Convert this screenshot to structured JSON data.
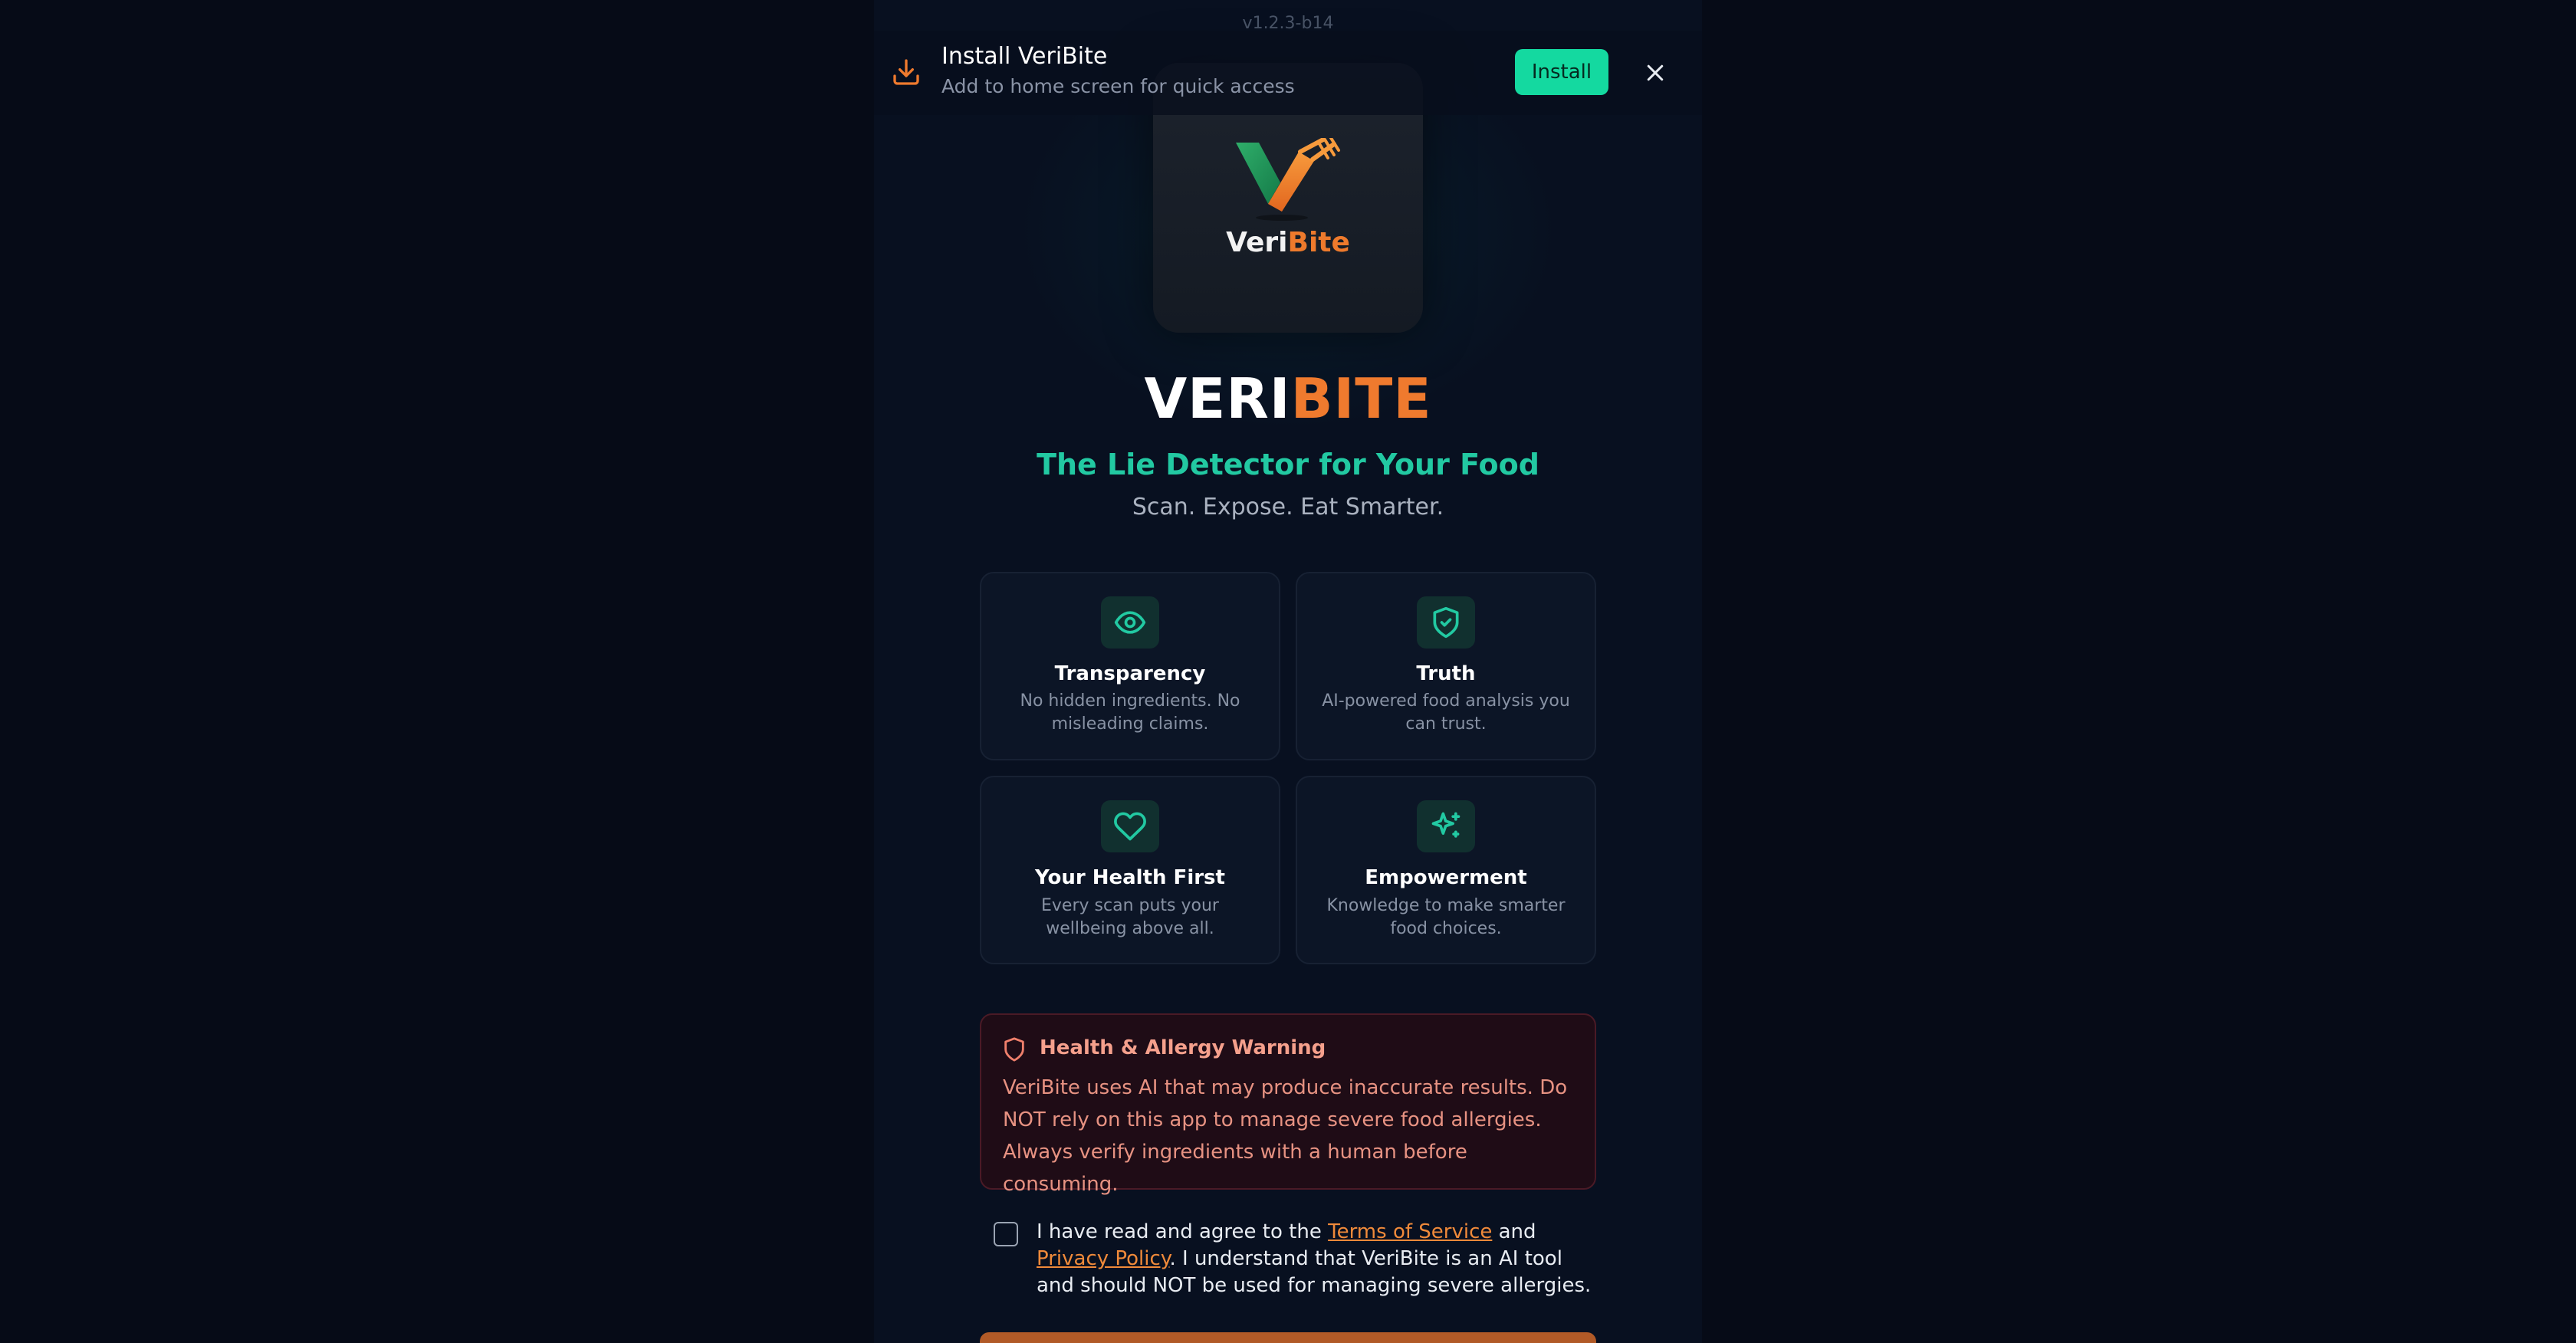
{
  "version": "v1.2.3-b14",
  "install_banner": {
    "title": "Install VeriBite",
    "subtitle": "Add to home screen for quick access",
    "install_label": "Install"
  },
  "logo": {
    "word_part1": "Veri",
    "word_part2": "Bite"
  },
  "hero": {
    "title_part1": "VERI",
    "title_part2": "BITE",
    "tagline": "The Lie Detector for Your Food",
    "subtagline": "Scan. Expose. Eat Smarter."
  },
  "features": [
    {
      "icon": "eye-icon",
      "title": "Transparency",
      "desc": "No hidden ingredients. No misleading claims."
    },
    {
      "icon": "shield-check-icon",
      "title": "Truth",
      "desc": "AI-powered food analysis you can trust."
    },
    {
      "icon": "heart-icon",
      "title": "Your Health First",
      "desc": "Every scan puts your wellbeing above all."
    },
    {
      "icon": "sparkles-icon",
      "title": "Empowerment",
      "desc": "Knowledge to make smarter food choices."
    }
  ],
  "warning": {
    "title": "Health & Allergy Warning",
    "body": "VeriBite uses AI that may produce inaccurate results. Do NOT rely on this app to manage severe food allergies. Always verify ingredients with a human before consuming."
  },
  "agreement": {
    "prefix": "I have read and agree to the ",
    "terms_label": "Terms of Service",
    "and": " and ",
    "privacy_label": "Privacy Policy",
    "suffix": ". I understand that VeriBite is an AI tool and should NOT be used for managing severe allergies."
  },
  "colors": {
    "accent_teal": "#22c9a2",
    "accent_orange": "#ef7a2e",
    "install_green": "#14d9a0",
    "background": "#060b17"
  }
}
